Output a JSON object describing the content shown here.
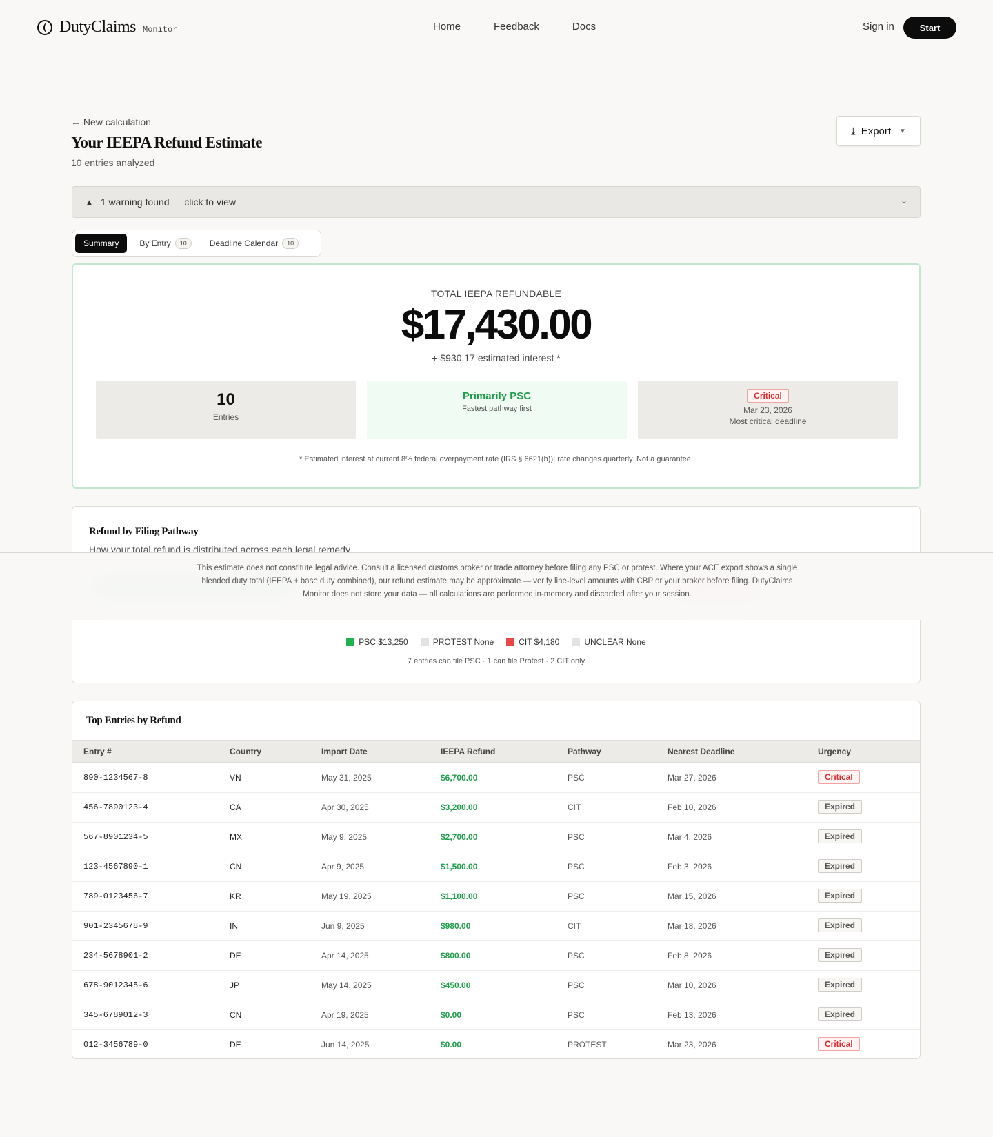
{
  "nav": {
    "brand": "DutyClaims",
    "tag": "Monitor",
    "links": [
      "Home",
      "Feedback",
      "Docs"
    ],
    "signin": "Sign in",
    "start": "Start"
  },
  "page": {
    "back": "← New calculation",
    "title": "Your IEEPA Refund Estimate",
    "subtitle": "10 entries analyzed",
    "export": "Export"
  },
  "warning": "1 warning found — click to view",
  "tabs": [
    {
      "label": "Summary"
    },
    {
      "label": "By Entry",
      "count": "10"
    },
    {
      "label": "Deadline Calendar",
      "count": "10"
    }
  ],
  "summary": {
    "label": "TOTAL IEEPA REFUNDABLE",
    "total": "$17,430.00",
    "interest": "+ $930.17 estimated interest *",
    "entries_value": "10",
    "entries_label": "Entries",
    "pathway_title": "Primarily PSC",
    "pathway_sub": "Fastest pathway first",
    "deadline_badge": "Critical",
    "deadline_date": "Mar 23, 2026",
    "deadline_label": "Most critical deadline",
    "footnote": "* Estimated interest at current 8% federal overpayment rate (IRS § 6621(b)); rate changes quarterly. Not a guarantee."
  },
  "pathway": {
    "title": "Refund by Filing Pathway",
    "subtitle": "How your total refund is distributed across each legal remedy",
    "legend": [
      {
        "label": "PSC $13,250",
        "color": "#22b14c"
      },
      {
        "label": "PROTEST None",
        "color": "#e3e3e3"
      },
      {
        "label": "CIT $4,180",
        "color": "#e94646"
      },
      {
        "label": "UNCLEAR None",
        "color": "#e3e3e3"
      }
    ],
    "note": "7 entries can file PSC · 1 can file Protest · 2 CIT only"
  },
  "disclaimer": "This estimate does not constitute legal advice. Consult a licensed customs broker or trade attorney before filing any PSC or protest. Where your ACE export shows a single blended duty total (IEEPA + base duty combined), our refund estimate may be approximate — verify line-level amounts with CBP or your broker before filing. DutyClaims Monitor does not store your data — all calculations are performed in-memory and discarded after your session.",
  "table": {
    "title": "Top Entries by Refund",
    "headers": [
      "Entry #",
      "Country",
      "Import Date",
      "IEEPA Refund",
      "Pathway",
      "Nearest Deadline",
      "Urgency"
    ],
    "rows": [
      {
        "entry": "890-1234567-8",
        "country": "VN",
        "date": "May 31, 2025",
        "refund": "$6,700.00",
        "pathway": "PSC",
        "deadline": "Mar 27, 2026",
        "urgency": "Critical"
      },
      {
        "entry": "456-7890123-4",
        "country": "CA",
        "date": "Apr 30, 2025",
        "refund": "$3,200.00",
        "pathway": "CIT",
        "deadline": "Feb 10, 2026",
        "urgency": "Expired"
      },
      {
        "entry": "567-8901234-5",
        "country": "MX",
        "date": "May 9, 2025",
        "refund": "$2,700.00",
        "pathway": "PSC",
        "deadline": "Mar 4, 2026",
        "urgency": "Expired"
      },
      {
        "entry": "123-4567890-1",
        "country": "CN",
        "date": "Apr 9, 2025",
        "refund": "$1,500.00",
        "pathway": "PSC",
        "deadline": "Feb 3, 2026",
        "urgency": "Expired"
      },
      {
        "entry": "789-0123456-7",
        "country": "KR",
        "date": "May 19, 2025",
        "refund": "$1,100.00",
        "pathway": "PSC",
        "deadline": "Mar 15, 2026",
        "urgency": "Expired"
      },
      {
        "entry": "901-2345678-9",
        "country": "IN",
        "date": "Jun 9, 2025",
        "refund": "$980.00",
        "pathway": "CIT",
        "deadline": "Mar 18, 2026",
        "urgency": "Expired"
      },
      {
        "entry": "234-5678901-2",
        "country": "DE",
        "date": "Apr 14, 2025",
        "refund": "$800.00",
        "pathway": "PSC",
        "deadline": "Feb 8, 2026",
        "urgency": "Expired"
      },
      {
        "entry": "678-9012345-6",
        "country": "JP",
        "date": "May 14, 2025",
        "refund": "$450.00",
        "pathway": "PSC",
        "deadline": "Mar 10, 2026",
        "urgency": "Expired"
      },
      {
        "entry": "345-6789012-3",
        "country": "CN",
        "date": "Apr 19, 2025",
        "refund": "$0.00",
        "pathway": "PSC",
        "deadline": "Feb 13, 2026",
        "urgency": "Expired"
      },
      {
        "entry": "012-3456789-0",
        "country": "DE",
        "date": "Jun 14, 2025",
        "refund": "$0.00",
        "pathway": "PROTEST",
        "deadline": "Mar 23, 2026",
        "urgency": "Critical"
      }
    ]
  }
}
